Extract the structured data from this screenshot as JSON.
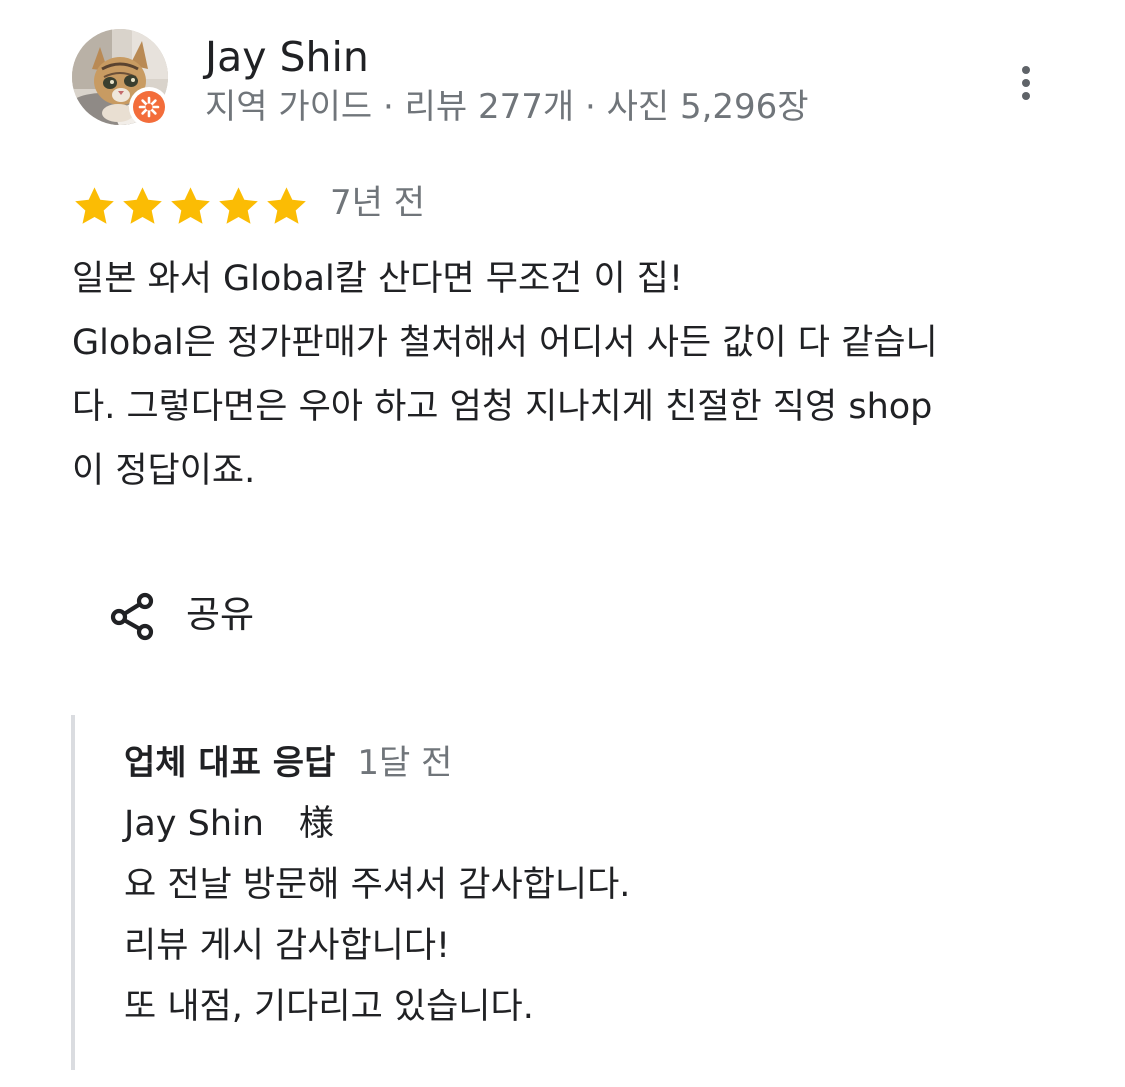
{
  "reviewer": {
    "name": "Jay Shin",
    "meta": "지역 가이드 · 리뷰 277개 · 사진 5,296장",
    "avatar_icon": "cat-photo-avatar",
    "badge_icon": "local-guide-badge-icon",
    "badge_color": "#f36d3b"
  },
  "menu": {
    "icon": "more-vert-icon"
  },
  "review": {
    "rating": 5,
    "rating_max": 5,
    "star_color": "#fbbc04",
    "age": "7년 전",
    "lines": [
      "일본 와서 Global칼 산다면 무조건 이 집!",
      "Global은 정가판매가 철처해서 어디서 사든 값이 다 같습니",
      "다. 그렇다면은 우아 하고 엄청 지나치게 친절한 직영 shop",
      "이 정답이죠."
    ]
  },
  "actions": {
    "share_label": "공유",
    "share_icon": "share-icon"
  },
  "owner_response": {
    "title": "업체 대표 응답",
    "age": "1달 전",
    "lines": [
      "Jay Shin　様",
      "요 전날 방문해 주셔서 감사합니다.",
      "리뷰 게시 감사합니다!",
      "또 내점, 기다리고 있습니다."
    ]
  },
  "colors": {
    "text_primary": "#202124",
    "text_secondary": "#70757a",
    "divider": "#dadce0"
  }
}
